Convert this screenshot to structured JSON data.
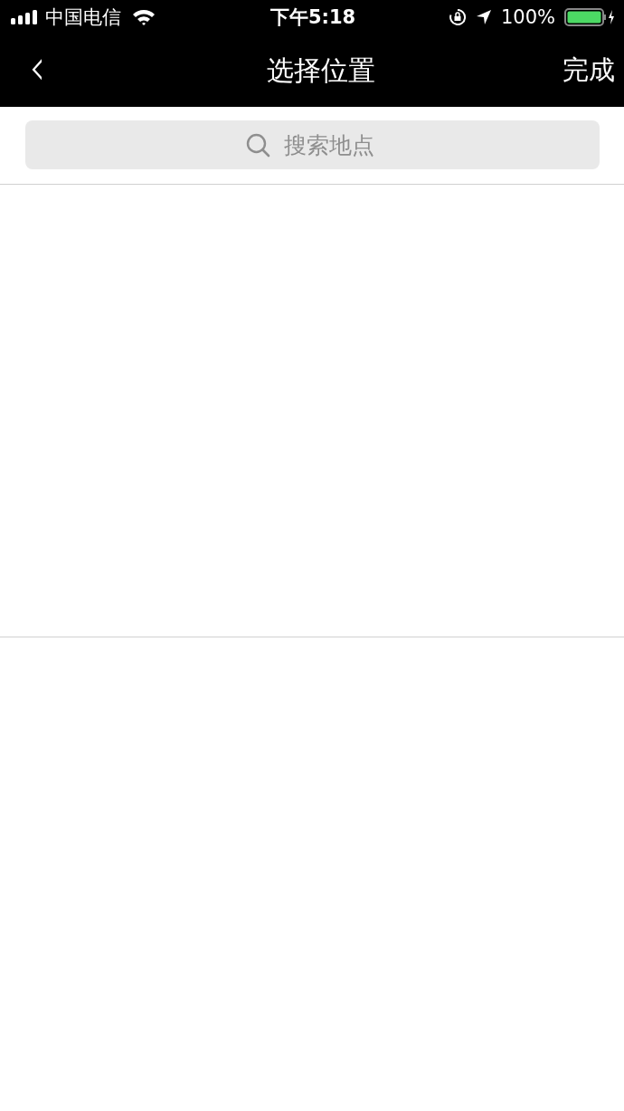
{
  "status_bar": {
    "carrier": "中国电信",
    "time": "下午5:18",
    "battery": "100%"
  },
  "nav_bar": {
    "back": "‹",
    "title": "选择位置",
    "action": "完成"
  },
  "search": {
    "placeholder": "搜索地点"
  }
}
